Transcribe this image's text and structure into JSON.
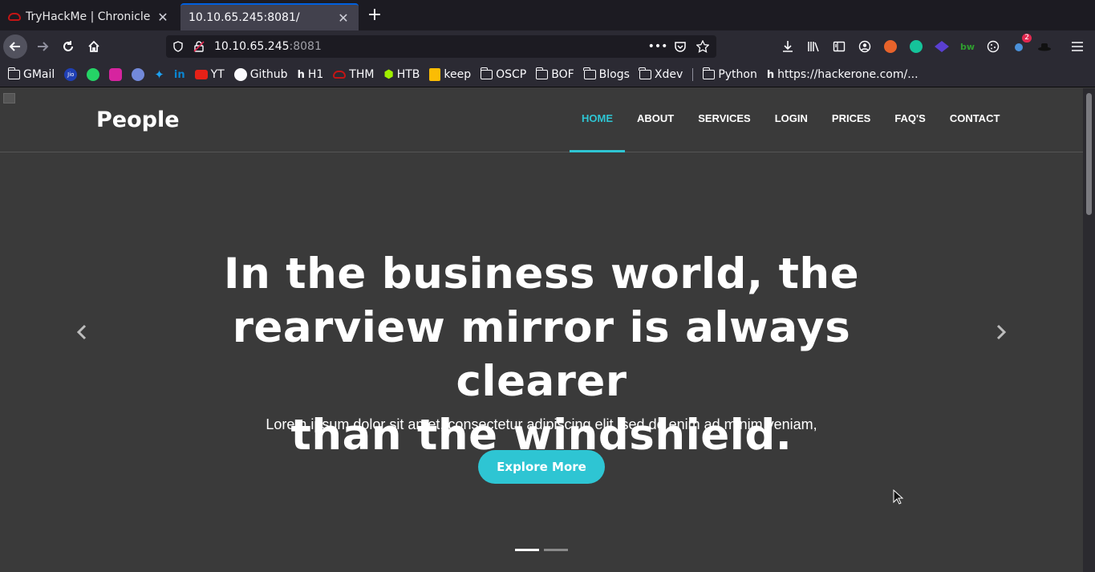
{
  "browser": {
    "tabs": [
      {
        "title": "TryHackMe | Chronicle",
        "active": false
      },
      {
        "title": "10.10.65.245:8081/",
        "active": true
      }
    ],
    "url_host": "10.10.65.245",
    "url_port": ":8081",
    "extension_badge": "2",
    "bookmarks": [
      {
        "label": "GMail",
        "icon": "folder-icon"
      },
      {
        "label": "",
        "icon": "jio-icon"
      },
      {
        "label": "",
        "icon": "whatsapp-icon"
      },
      {
        "label": "",
        "icon": "instagram-icon"
      },
      {
        "label": "",
        "icon": "discord-icon"
      },
      {
        "label": "",
        "icon": "twitter-icon"
      },
      {
        "label": "",
        "icon": "linkedin-icon"
      },
      {
        "label": "YT",
        "icon": "youtube-icon"
      },
      {
        "label": "Github",
        "icon": "github-icon"
      },
      {
        "label": "H1",
        "icon": "hackerone-icon"
      },
      {
        "label": "THM",
        "icon": "tryhackme-icon"
      },
      {
        "label": "HTB",
        "icon": "hackthebox-icon"
      },
      {
        "label": "keep",
        "icon": "keep-icon"
      },
      {
        "label": "OSCP",
        "icon": "folder-icon"
      },
      {
        "label": "BOF",
        "icon": "folder-icon"
      },
      {
        "label": "Blogs",
        "icon": "folder-icon"
      },
      {
        "label": "Xdev",
        "icon": "folder-icon"
      },
      {
        "label": "Python",
        "icon": "folder-icon"
      },
      {
        "label": "https://hackerone.com/...",
        "icon": "hackerone-icon"
      }
    ]
  },
  "site": {
    "logo": "People",
    "nav": [
      {
        "label": "HOME",
        "active": true
      },
      {
        "label": "ABOUT",
        "active": false
      },
      {
        "label": "SERVICES",
        "active": false
      },
      {
        "label": "LOGIN",
        "active": false
      },
      {
        "label": "PRICES",
        "active": false
      },
      {
        "label": "FAQ'S",
        "active": false
      },
      {
        "label": "CONTACT",
        "active": false
      }
    ],
    "hero": {
      "title_line1": "In the business world, the",
      "title_line2": "rearview mirror is always clearer",
      "title_line3": "than the windshield.",
      "subtitle": "Lorem ipsum dolor sit amet, consectetur adipiscing elit, sed do enim ad minim veniam,",
      "button_label": "Explore More",
      "slides": 2,
      "active_slide": 1
    }
  },
  "colors": {
    "accent": "#2ec5d3",
    "page_bg": "#3a3a3a",
    "chrome_bg": "#2b2a33"
  }
}
